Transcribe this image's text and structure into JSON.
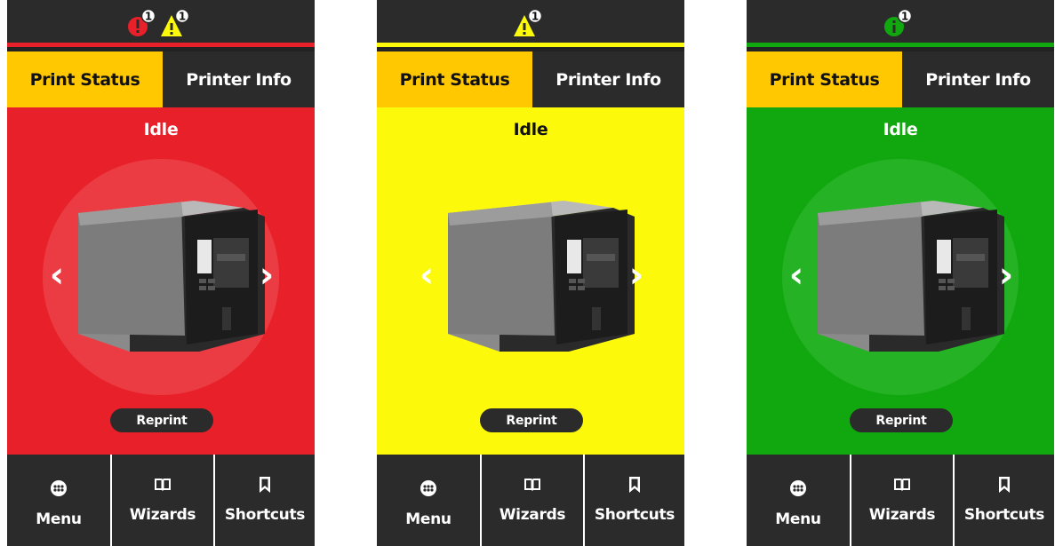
{
  "screens": [
    {
      "theme": "red",
      "background": "#e8202a",
      "halo": "#ec3c43",
      "stripe": "#e8202a",
      "alerts": [
        "error-badge-icon",
        "warning-badge-icon"
      ],
      "alert_count": "1",
      "tabs": {
        "print_status": "Print Status",
        "printer_info": "Printer Info"
      },
      "state": "Idle",
      "reprint": "Reprint",
      "nav": {
        "menu": "Menu",
        "wizards": "Wizards",
        "shortcuts": "Shortcuts"
      }
    },
    {
      "theme": "yellow",
      "background": "#fdf90a",
      "halo": "#fdf90a",
      "stripe": "#fdf90a",
      "alerts": [
        "warning-badge-icon"
      ],
      "alert_count": "1",
      "tabs": {
        "print_status": "Print Status",
        "printer_info": "Printer Info"
      },
      "state": "Idle",
      "reprint": "Reprint",
      "nav": {
        "menu": "Menu",
        "wizards": "Wizards",
        "shortcuts": "Shortcuts"
      }
    },
    {
      "theme": "green",
      "background": "#11a80f",
      "halo": "#25b224",
      "stripe": "#11a80f",
      "alerts": [
        "info-badge-icon"
      ],
      "alert_count": "1",
      "tabs": {
        "print_status": "Print Status",
        "printer_info": "Printer Info"
      },
      "state": "Idle",
      "reprint": "Reprint",
      "nav": {
        "menu": "Menu",
        "wizards": "Wizards",
        "shortcuts": "Shortcuts"
      }
    }
  ]
}
